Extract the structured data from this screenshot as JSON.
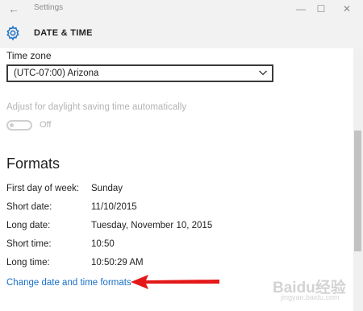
{
  "window": {
    "app_title": "Settings",
    "back_glyph": "←",
    "minimize_glyph": "—",
    "maximize_glyph": "☐",
    "close_glyph": "✕"
  },
  "header": {
    "icon": "gear-icon",
    "title": "DATE & TIME"
  },
  "timezone": {
    "label": "Time zone",
    "selected": "(UTC-07:00) Arizona"
  },
  "dst": {
    "label": "Adjust for daylight saving time automatically",
    "toggle_state": "Off",
    "enabled": false
  },
  "formats": {
    "title": "Formats",
    "rows": [
      {
        "label": "First day of week:",
        "value": "Sunday"
      },
      {
        "label": "Short date:",
        "value": "11/10/2015"
      },
      {
        "label": "Long date:",
        "value": "Tuesday, November 10, 2015"
      },
      {
        "label": "Short time:",
        "value": "10:50"
      },
      {
        "label": "Long time:",
        "value": "10:50:29 AM"
      }
    ],
    "change_link": "Change date and time formats"
  },
  "annotation": {
    "arrow_color": "#e41818"
  },
  "watermark": {
    "text": "Baidu经验",
    "sub": "jingyan.baidu.com"
  },
  "colors": {
    "link": "#1a6fc6",
    "chrome": "#f2f2f2",
    "disabled_text": "#b4b4b4"
  }
}
